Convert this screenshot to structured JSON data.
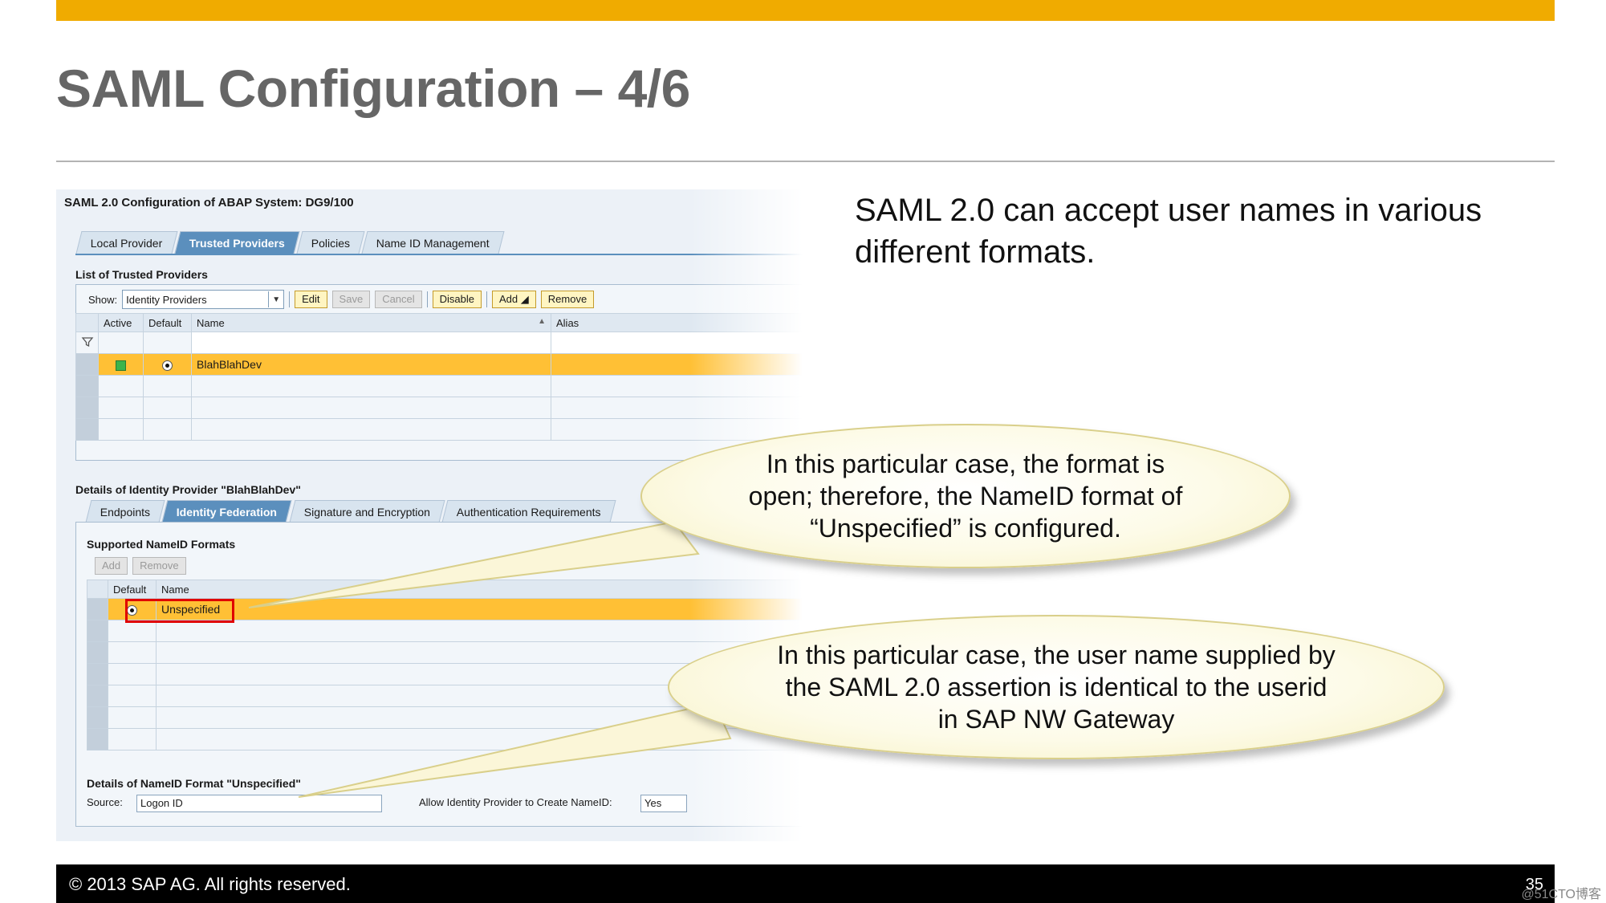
{
  "slide": {
    "title": "SAML Configuration – 4/6",
    "description": "SAML 2.0 can accept user names in various different formats.",
    "callout1": "In this particular case, the format is open; therefore, the NameID format of “Unspecified” is configured.",
    "callout2": "In this particular case, the user name supplied by the SAML 2.0 assertion is identical to the userid in SAP NW Gateway",
    "footer": "©  2013 SAP AG. All rights reserved.",
    "page_number": "35",
    "watermark": "@51CTO博客",
    "accent_color": "#f0ab00"
  },
  "sap": {
    "title": "SAML 2.0 Configuration of ABAP System: DG9/100",
    "tabs": [
      {
        "label": "Local Provider"
      },
      {
        "label": "Trusted Providers"
      },
      {
        "label": "Policies"
      },
      {
        "label": "Name ID Management"
      }
    ],
    "list_title": "List of Trusted Providers",
    "show_label": "Show:",
    "show_value": "Identity Providers",
    "buttons": {
      "edit": "Edit",
      "save": "Save",
      "cancel": "Cancel",
      "disable": "Disable",
      "add": "Add ◢",
      "remove": "Remove"
    },
    "columns": {
      "active": "Active",
      "default": "Default",
      "name": "Name",
      "alias": "Alias"
    },
    "provider_row": {
      "name": "BlahBlahDev"
    },
    "details_title": "Details of Identity Provider \"BlahBlahDev\"",
    "detail_tabs": [
      {
        "label": "Endpoints"
      },
      {
        "label": "Identity Federation"
      },
      {
        "label": "Signature and Encryption"
      },
      {
        "label": "Authentication Requirements"
      }
    ],
    "nameid_title": "Supported NameID Formats",
    "nameid_buttons": {
      "add": "Add",
      "remove": "Remove"
    },
    "nameid_columns": {
      "default": "Default",
      "name": "Name"
    },
    "nameid_row": {
      "name": "Unspecified"
    },
    "format_details_title": "Details of NameID Format \"Unspecified\"",
    "source_label": "Source:",
    "source_value": "Logon ID",
    "allow_label": "Allow Identity Provider to Create NameID:",
    "allow_value": "Yes"
  }
}
